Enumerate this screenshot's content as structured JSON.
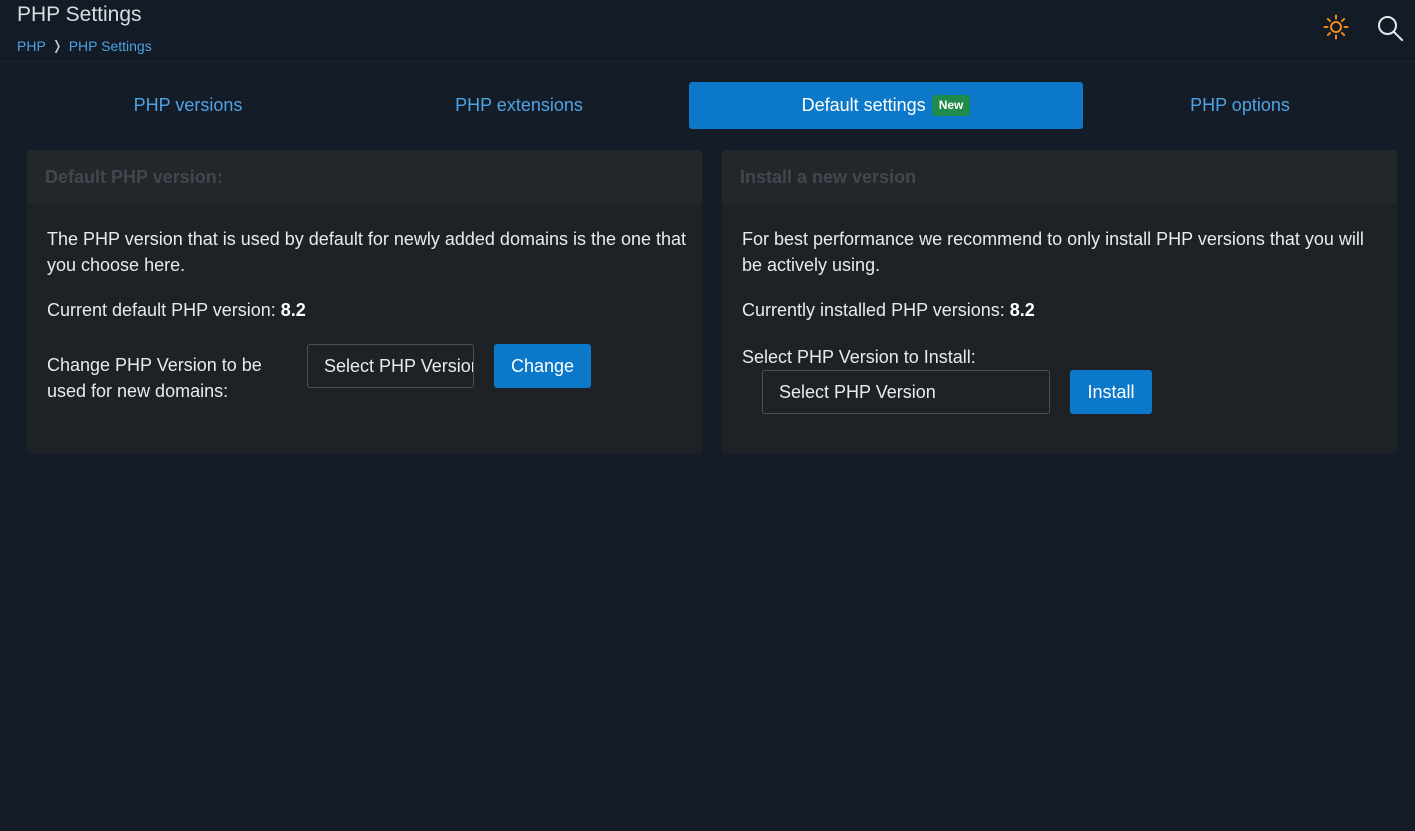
{
  "header": {
    "title": "PHP Settings",
    "breadcrumb": [
      {
        "label": "PHP"
      },
      {
        "label": "PHP Settings"
      }
    ],
    "icons": {
      "theme": "sun-icon",
      "search": "search-icon"
    }
  },
  "tabs": [
    {
      "label": "PHP versions",
      "active": false
    },
    {
      "label": "PHP extensions",
      "active": false
    },
    {
      "label": "Default settings",
      "badge": "New",
      "active": true
    },
    {
      "label": "PHP options",
      "active": false
    }
  ],
  "default_panel": {
    "title": "Default PHP version:",
    "description": "The PHP version that is used by default for newly added domains is the one that you choose here.",
    "current_label": "Current default PHP version:",
    "current_value": "8.2",
    "change_label": "Change PHP Version to be used for new domains:",
    "select_value": "Select PHP Version",
    "button_label": "Change"
  },
  "install_panel": {
    "title": "Install a new version",
    "description": "For best performance we recommend to only install PHP versions that you will be actively using.",
    "current_label": "Currently installed PHP versions:",
    "current_value": "8.2",
    "select_label": "Select PHP Version to Install:",
    "select_value": "Select PHP Version",
    "button_label": "Install"
  },
  "colors": {
    "background": "#141c28",
    "accent": "#0b78c9",
    "link": "#4fa3e3",
    "badge": "#1e8a4c",
    "sun": "#f08a1c"
  }
}
